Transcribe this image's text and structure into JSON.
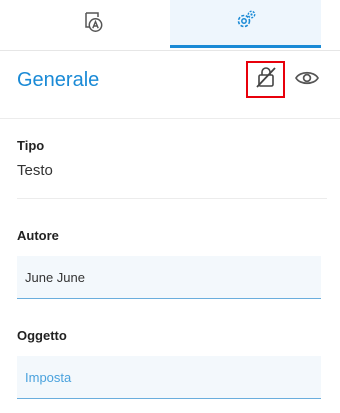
{
  "tabs": [
    {
      "icon": "annotation-icon",
      "active": false
    },
    {
      "icon": "gear-icon",
      "active": true
    }
  ],
  "section": {
    "title": "Generale",
    "actions": [
      {
        "icon": "lock-off-icon"
      },
      {
        "icon": "eye-icon"
      }
    ]
  },
  "fields": {
    "type_label": "Tipo",
    "type_value": "Testo",
    "author_label": "Autore",
    "author_value": "June June",
    "subject_label": "Oggetto",
    "subject_value": "Imposta"
  },
  "colors": {
    "accent": "#1a8ad6",
    "highlight": "#e8000b",
    "field_bg": "#f3f8fc"
  }
}
